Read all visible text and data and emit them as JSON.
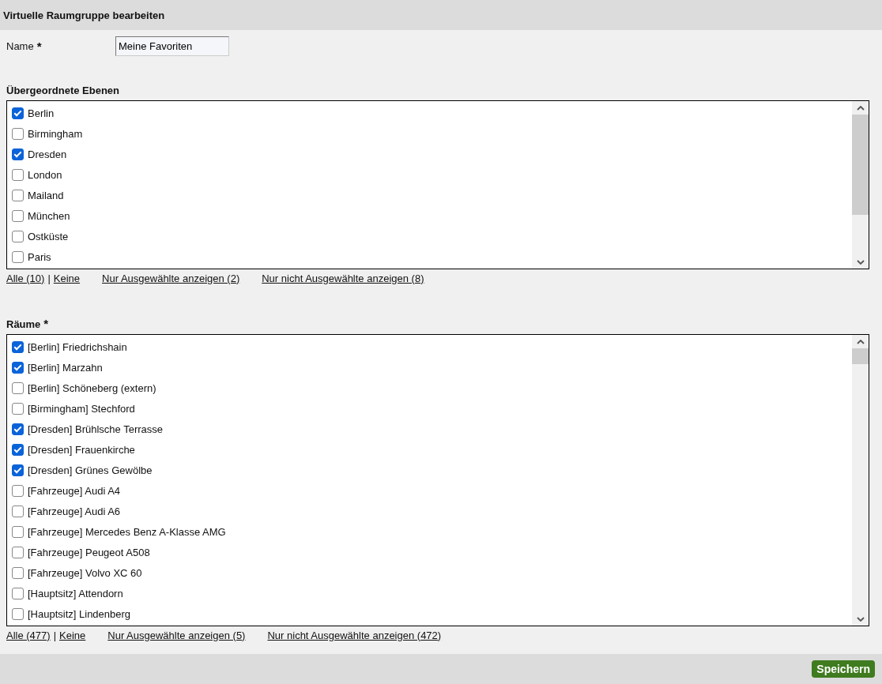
{
  "header": {
    "title": "Virtuelle Raumgruppe bearbeiten"
  },
  "name_field": {
    "label": "Name",
    "required_mark": "*",
    "value": "Meine Favoriten"
  },
  "lists": [
    {
      "heading": "Übergeordnete Ebenen",
      "items": [
        {
          "label": "Berlin",
          "checked": true
        },
        {
          "label": "Birmingham",
          "checked": false
        },
        {
          "label": "Dresden",
          "checked": true
        },
        {
          "label": "London",
          "checked": false
        },
        {
          "label": "Mailand",
          "checked": false
        },
        {
          "label": "München",
          "checked": false
        },
        {
          "label": "Ostküste",
          "checked": false
        },
        {
          "label": "Paris",
          "checked": false
        }
      ],
      "links": {
        "all": "Alle (10)",
        "separator": "|",
        "none": "Keine",
        "only_selected": "Nur Ausgewählte anzeigen (2)",
        "only_unselected": "Nur nicht Ausgewählte anzeigen (8)"
      }
    },
    {
      "heading": "Räume",
      "required_mark": "*",
      "items": [
        {
          "label": "[Berlin] Friedrichshain",
          "checked": true
        },
        {
          "label": "[Berlin] Marzahn",
          "checked": true
        },
        {
          "label": "[Berlin] Schöneberg (extern)",
          "checked": false
        },
        {
          "label": "[Birmingham] Stechford",
          "checked": false
        },
        {
          "label": "[Dresden] Brühlsche Terrasse",
          "checked": true
        },
        {
          "label": "[Dresden] Frauenkirche",
          "checked": true
        },
        {
          "label": "[Dresden] Grünes Gewölbe",
          "checked": true
        },
        {
          "label": "[Fahrzeuge] Audi A4",
          "checked": false
        },
        {
          "label": "[Fahrzeuge] Audi A6",
          "checked": false
        },
        {
          "label": "[Fahrzeuge] Mercedes Benz A-Klasse AMG",
          "checked": false
        },
        {
          "label": "[Fahrzeuge] Peugeot A508",
          "checked": false
        },
        {
          "label": "[Fahrzeuge] Volvo XC 60",
          "checked": false
        },
        {
          "label": "[Hauptsitz] Attendorn",
          "checked": false
        },
        {
          "label": "[Hauptsitz] Lindenberg",
          "checked": false
        }
      ],
      "links": {
        "all": "Alle (477)",
        "separator": "|",
        "none": "Keine",
        "only_selected": "Nur Ausgewählte anzeigen (5)",
        "only_unselected": "Nur nicht Ausgewählte anzeigen (472)"
      }
    }
  ],
  "footer": {
    "save_button": "Speichern"
  }
}
